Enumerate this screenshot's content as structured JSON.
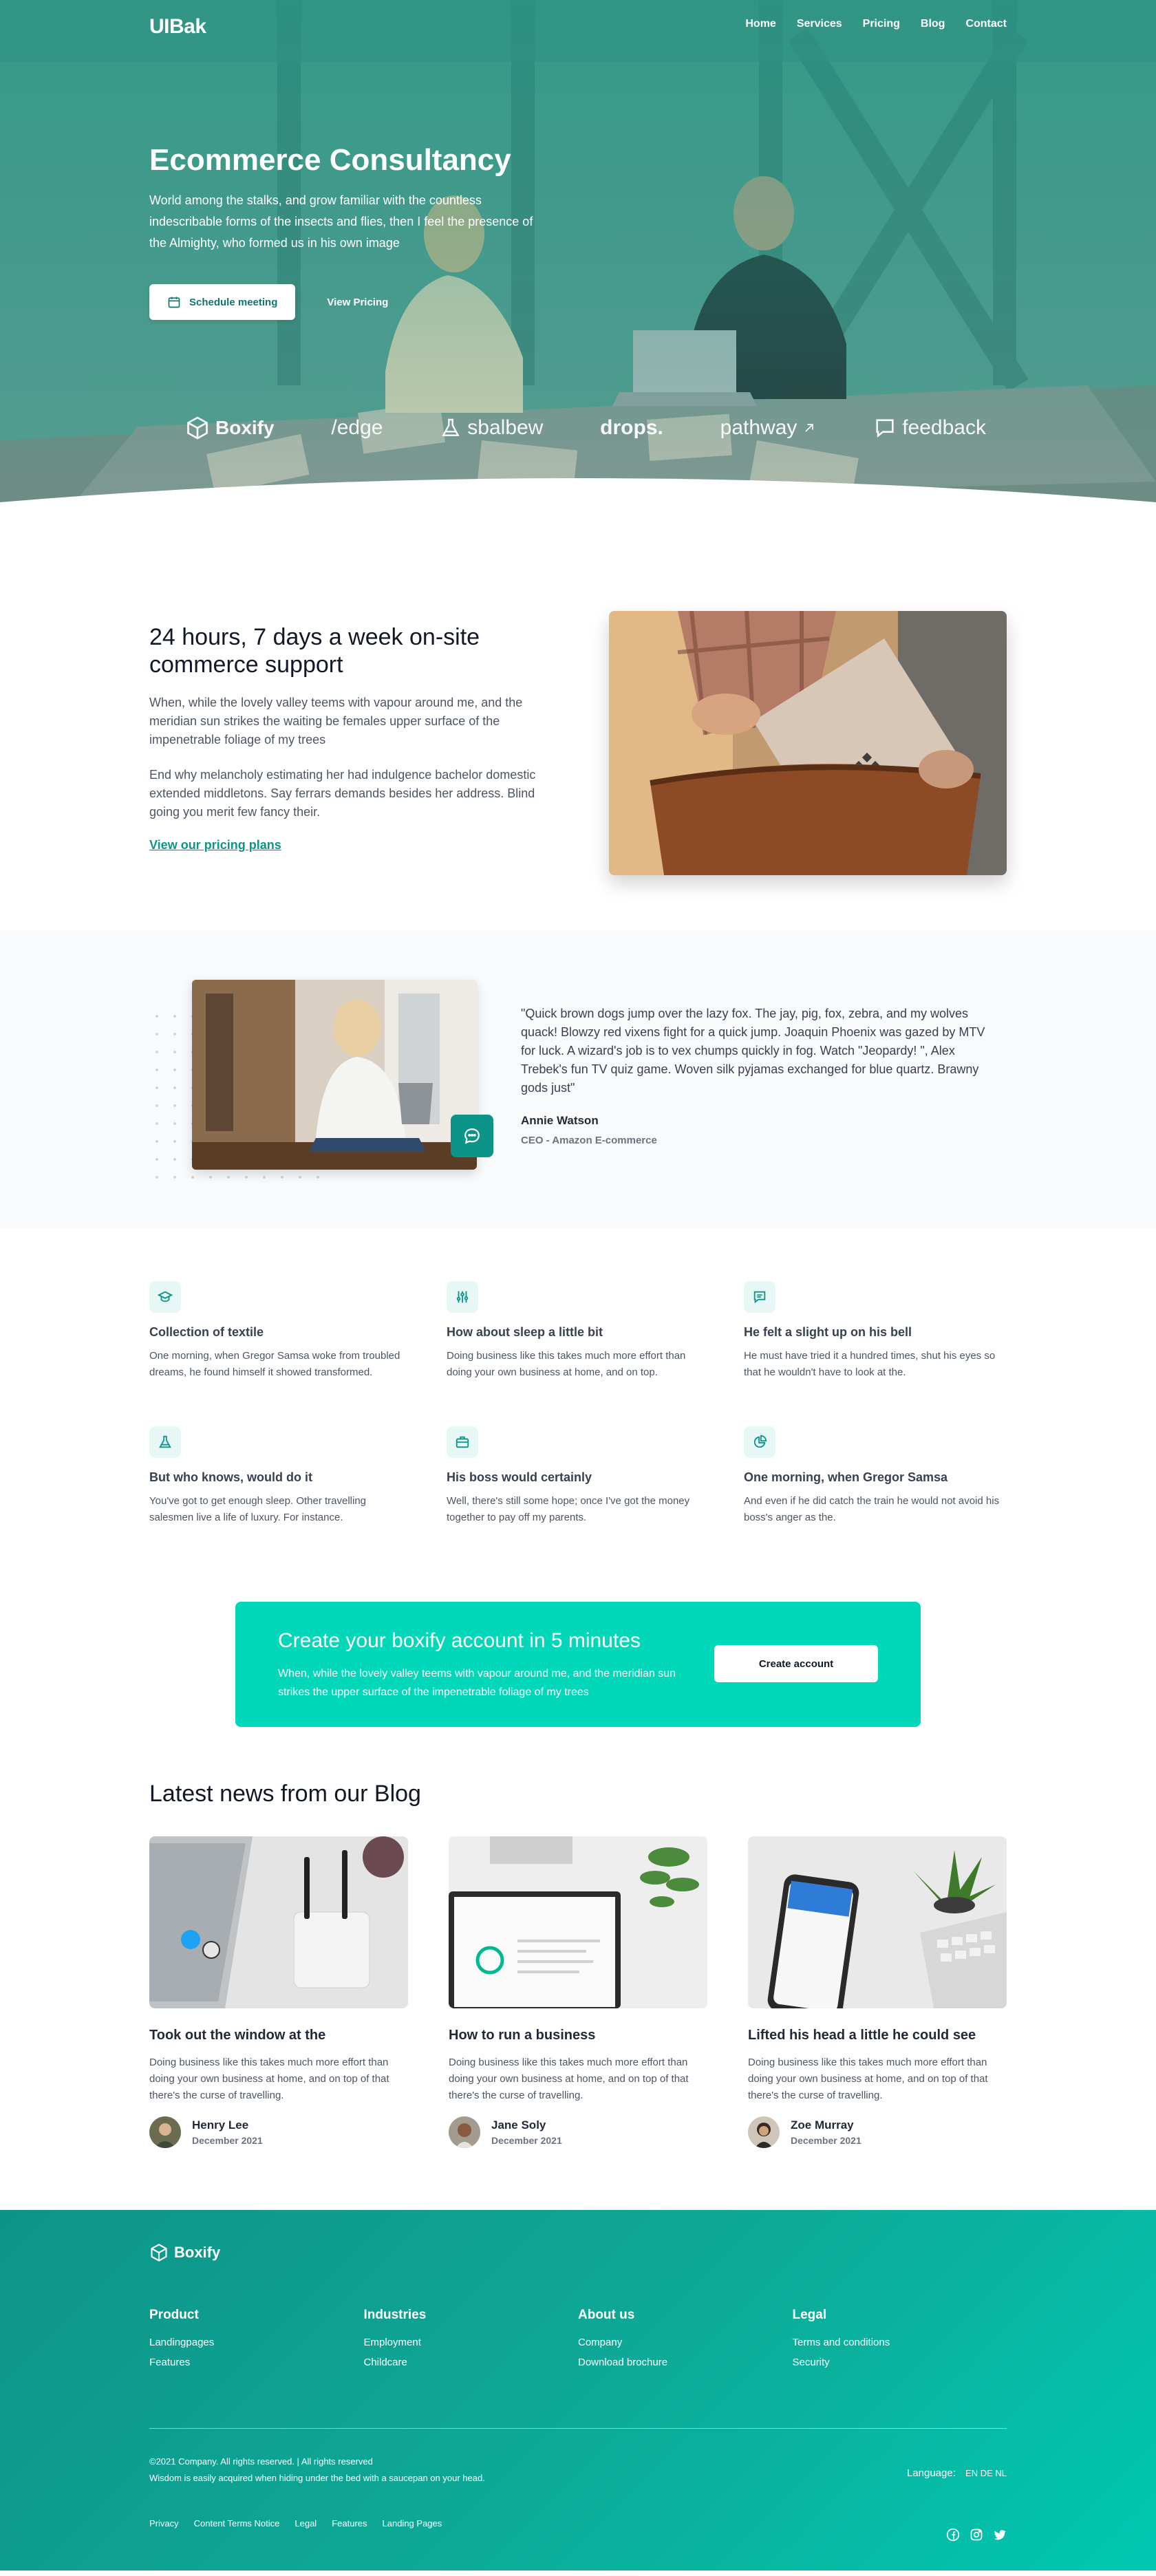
{
  "header": {
    "logo": "UIBak",
    "nav": [
      "Home",
      "Services",
      "Pricing",
      "Blog",
      "Contact"
    ]
  },
  "hero": {
    "title": "Ecommerce Consultancy",
    "description": "World among the stalks, and grow familiar with the countless indescribable forms of the insects and flies, then I feel the presence of the Almighty, who formed us in his own image",
    "primary_button": "Schedule meeting",
    "secondary_button": "View Pricing",
    "brands": [
      "Boxify",
      "/edge",
      "sbalbew",
      "drops.",
      "pathway",
      "feedback"
    ]
  },
  "support": {
    "title": "24 hours, 7 days a week on-site commerce support",
    "para1": "When, while the lovely valley teems with vapour around me, and the meridian sun strikes the waiting be females upper surface of the impenetrable foliage of my trees",
    "para2": "End why melancholy estimating her had indulgence bachelor domestic extended middletons. Say ferrars demands besides her address. Blind going you merit few fancy their.",
    "link": "View our pricing plans"
  },
  "testimonial": {
    "quote": "\"Quick brown dogs jump over the lazy fox. The jay, pig, fox, zebra, and my wolves quack! Blowzy red vixens fight for a quick jump. Joaquin Phoenix was gazed by MTV for luck. A wizard's job is to vex chumps quickly in fog. Watch \"Jeopardy! \", Alex Trebek's fun TV quiz game. Woven silk pyjamas exchanged for blue quartz. Brawny gods just\"",
    "name": "Annie Watson",
    "role": "CEO - Amazon E-commerce"
  },
  "features": [
    {
      "icon": "graduation-cap-icon",
      "title": "Collection of textile",
      "desc": "One morning, when Gregor Samsa woke from troubled dreams, he found himself it showed transformed."
    },
    {
      "icon": "sliders-icon",
      "title": "How about sleep a little bit",
      "desc": "Doing business like this takes much more effort than doing your own business at home, and on top."
    },
    {
      "icon": "message-icon",
      "title": "He felt a slight up on his bell",
      "desc": "He must have tried it a hundred times, shut his eyes so that he wouldn't have to look at the."
    },
    {
      "icon": "flask-icon",
      "title": "But who knows, would do it",
      "desc": "You've got to get enough sleep. Other travelling salesmen live a life of luxury. For instance."
    },
    {
      "icon": "briefcase-icon",
      "title": "His boss would certainly",
      "desc": "Well, there's still some hope; once I've got the money together to pay off my parents."
    },
    {
      "icon": "pie-chart-icon",
      "title": "One morning, when Gregor Samsa",
      "desc": "And even if he did catch the train he would not avoid his boss's anger as the."
    }
  ],
  "cta": {
    "title": "Create your boxify account in 5 minutes",
    "desc": "When, while the lovely valley teems with vapour around me, and the meridian sun strikes the upper surface of the impenetrable foliage of my trees",
    "button": "Create account"
  },
  "blog": {
    "title": "Latest news from our Blog",
    "posts": [
      {
        "title": "Took out the window at the",
        "desc": "Doing business like this takes much more effort than doing your own business at home, and on top of that there's the curse of travelling.",
        "author": "Henry Lee",
        "date": "December 2021"
      },
      {
        "title": "How to run a business",
        "desc": "Doing business like this takes much more effort than doing your own business at home, and on top of that there's the curse of travelling.",
        "author": "Jane Soly",
        "date": "December 2021"
      },
      {
        "title": "Lifted his head a little he could see",
        "desc": "Doing business like this takes much more effort than doing your own business at home, and on top of that there's the curse of travelling.",
        "author": "Zoe Murray",
        "date": "December 2021"
      }
    ]
  },
  "footer": {
    "logo": "Boxify",
    "columns": [
      {
        "title": "Product",
        "links": [
          "Landingpages",
          "Features"
        ]
      },
      {
        "title": "Industries",
        "links": [
          "Employment",
          "Childcare"
        ]
      },
      {
        "title": "About us",
        "links": [
          "Company",
          "Download brochure"
        ]
      },
      {
        "title": "Legal",
        "links": [
          "Terms and conditions",
          "Security"
        ]
      }
    ],
    "copyright": "©2021 Company. All rights reserved. | All rights reserved",
    "tagline": "Wisdom is easily acquired when hiding under the bed with a saucepan on your head.",
    "language_label": "Language:",
    "language_codes": "EN DE NL",
    "bottom_links": [
      "Privacy",
      "Content Terms Notice",
      "Legal",
      "Features",
      "Landing Pages"
    ]
  }
}
